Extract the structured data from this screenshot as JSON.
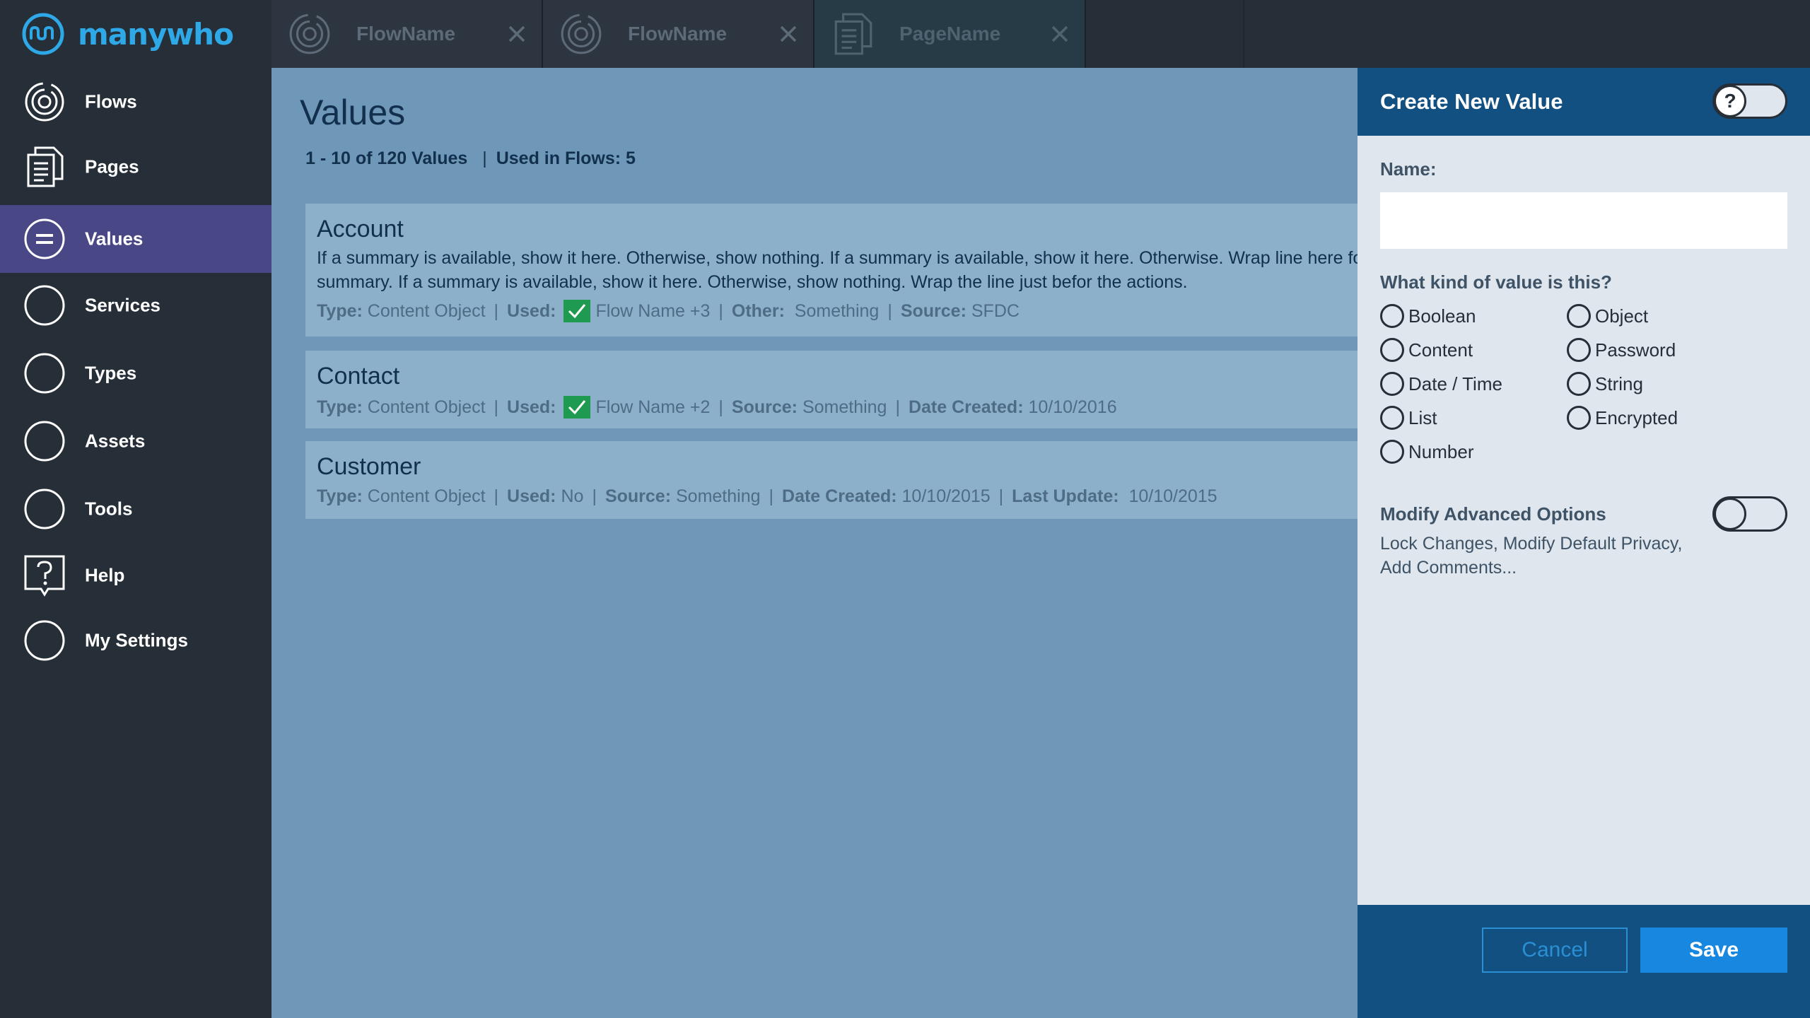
{
  "app": {
    "logo_text": "manywho"
  },
  "sidebar": {
    "items": [
      {
        "label": "Flows",
        "icon": "target-icon"
      },
      {
        "label": "Pages",
        "icon": "document-icon"
      },
      {
        "label": "Values",
        "icon": "equals-circle-icon",
        "active": true
      },
      {
        "label": "Services",
        "icon": "circle-icon"
      },
      {
        "label": "Types",
        "icon": "circle-icon"
      },
      {
        "label": "Assets",
        "icon": "circle-icon"
      },
      {
        "label": "Tools",
        "icon": "circle-icon"
      },
      {
        "label": "Help",
        "icon": "help-square-icon"
      },
      {
        "label": "My Settings",
        "icon": "circle-icon"
      }
    ]
  },
  "tabs": [
    {
      "label": "FlowName",
      "icon": "target-icon"
    },
    {
      "label": "FlowName",
      "icon": "target-icon"
    },
    {
      "label": "PageName",
      "icon": "document-icon",
      "active": true
    }
  ],
  "main": {
    "title": "Values",
    "range": "1 - 10 of 120 Values",
    "sep": "|",
    "used_in_flows": "Used in Flows: 5",
    "cards": [
      {
        "title": "Account",
        "description": "If a summary is available, show it here. Otherwise, show nothing. If a summary is available, show it here. Otherwise. Wrap line here for summary.  If a summary is available, show it here. Otherwise, show nothing.  Wrap the line just befor the actions.",
        "type_key": "Type:",
        "type_val": "Content Object",
        "used_key": "Used:",
        "used_val": "Flow Name +3",
        "other_key": "Other:",
        "other_val": "Something",
        "source_key": "Source:",
        "source_val": "SFDC"
      },
      {
        "title": "Contact",
        "type_key": "Type:",
        "type_val": "Content Object",
        "used_key": "Used:",
        "used_val": "Flow Name +2",
        "source_key": "Source:",
        "source_val": "Something",
        "created_key": "Date Created:",
        "created_val": "10/10/2016"
      },
      {
        "title": "Customer",
        "type_key": "Type:",
        "type_val": "Content Object",
        "used_key": "Used:",
        "used_val": "No",
        "source_key": "Source:",
        "source_val": "Something",
        "created_key": "Date Created:",
        "created_val": "10/10/2015",
        "updated_key": "Last Update:",
        "updated_val": "10/10/2015"
      }
    ]
  },
  "panel": {
    "title": "Create New Value",
    "help_glyph": "?",
    "name_label": "Name:",
    "name_value": "",
    "kind_label": "What kind of value is this?",
    "kinds": [
      "Boolean",
      "Object",
      "Content",
      "Password",
      "Date / Time",
      "String",
      "List",
      "Encrypted",
      "Number"
    ],
    "advanced_title": "Modify Advanced Options",
    "advanced_desc": "Lock Changes, Modify Default Privacy, Add Comments...",
    "cancel_label": "Cancel",
    "save_label": "Save"
  },
  "colors": {
    "sidebar_bg": "#262e37",
    "active_nav": "#4a4787",
    "brand": "#2ea8e6",
    "main_bg": "#6e97b8",
    "card_bg": "#8cb0c9",
    "panel_header": "#125082",
    "save_button": "#1787e0",
    "check_green": "#1f9b51"
  }
}
